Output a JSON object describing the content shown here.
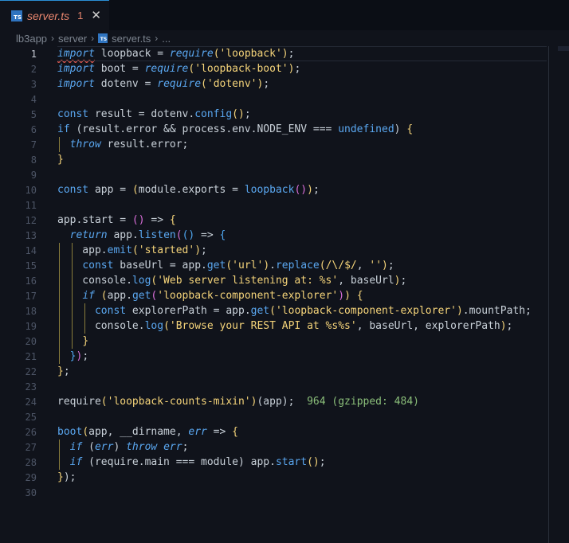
{
  "tab": {
    "filename": "server.ts",
    "problems": "1",
    "close": "✕",
    "badge": "TS"
  },
  "breadcrumb": {
    "root": "lb3app",
    "folder": "server",
    "file": "server.ts",
    "more": "...",
    "sep": "›"
  },
  "inlay_hint": "964 (gzipped: 484)",
  "colors": {
    "keyword": "#5aa7f0",
    "string": "#f5d47a",
    "error": "#e8866e",
    "hint": "#8bbf7a"
  },
  "lines": [
    {
      "n": "1",
      "t": [
        [
          "k",
          "import"
        ],
        [
          "m",
          " loopback = "
        ],
        [
          "f",
          "require"
        ],
        [
          "p",
          "("
        ],
        [
          "s",
          "'loopback'"
        ],
        [
          "p",
          ")"
        ],
        [
          "m",
          ";"
        ]
      ]
    },
    {
      "n": "2",
      "t": [
        [
          "k",
          "import"
        ],
        [
          "m",
          " boot = "
        ],
        [
          "f",
          "require"
        ],
        [
          "p",
          "("
        ],
        [
          "s",
          "'loopback-boot'"
        ],
        [
          "p",
          ")"
        ],
        [
          "m",
          ";"
        ]
      ]
    },
    {
      "n": "3",
      "t": [
        [
          "k",
          "import"
        ],
        [
          "m",
          " dotenv = "
        ],
        [
          "f",
          "require"
        ],
        [
          "p",
          "("
        ],
        [
          "s",
          "'dotenv'"
        ],
        [
          "p",
          ")"
        ],
        [
          "m",
          ";"
        ]
      ]
    },
    {
      "n": "4",
      "t": []
    },
    {
      "n": "5",
      "t": [
        [
          "d",
          "const"
        ],
        [
          "m",
          " result = dotenv."
        ],
        [
          "d",
          "config"
        ],
        [
          "p",
          "()"
        ],
        [
          "m",
          ";"
        ]
      ]
    },
    {
      "n": "6",
      "t": [
        [
          "d",
          "if"
        ],
        [
          "m",
          " (result.error && process.env.NODE_ENV === "
        ],
        [
          "d",
          "undefined"
        ],
        [
          "m",
          ") "
        ],
        [
          "p",
          "{"
        ]
      ]
    },
    {
      "n": "7",
      "t": [
        [
          "m",
          "  "
        ],
        [
          "k",
          "throw"
        ],
        [
          "m",
          " result.error;"
        ]
      ]
    },
    {
      "n": "8",
      "t": [
        [
          "p",
          "}"
        ]
      ]
    },
    {
      "n": "9",
      "t": []
    },
    {
      "n": "10",
      "t": [
        [
          "d",
          "const"
        ],
        [
          "m",
          " app = "
        ],
        [
          "p",
          "("
        ],
        [
          "m",
          "module.exports = "
        ],
        [
          "d",
          "loopback"
        ],
        [
          "pp",
          "()"
        ],
        [
          "p",
          ")"
        ],
        [
          "m",
          ";"
        ]
      ]
    },
    {
      "n": "11",
      "t": []
    },
    {
      "n": "12",
      "t": [
        [
          "m",
          "app.start = "
        ],
        [
          "pp",
          "()"
        ],
        [
          "m",
          " => "
        ],
        [
          "p",
          "{"
        ]
      ]
    },
    {
      "n": "13",
      "t": [
        [
          "m",
          "  "
        ],
        [
          "k",
          "return"
        ],
        [
          "m",
          " app."
        ],
        [
          "d",
          "listen"
        ],
        [
          "pp",
          "("
        ],
        [
          "pb",
          "()"
        ],
        [
          "m",
          " => "
        ],
        [
          "pb",
          "{"
        ]
      ]
    },
    {
      "n": "14",
      "t": [
        [
          "m",
          "    app."
        ],
        [
          "d",
          "emit"
        ],
        [
          "p",
          "("
        ],
        [
          "s",
          "'started'"
        ],
        [
          "p",
          ")"
        ],
        [
          "m",
          ";"
        ]
      ]
    },
    {
      "n": "15",
      "t": [
        [
          "m",
          "    "
        ],
        [
          "d",
          "const"
        ],
        [
          "m",
          " baseUrl = app."
        ],
        [
          "d",
          "get"
        ],
        [
          "p",
          "("
        ],
        [
          "s",
          "'url'"
        ],
        [
          "p",
          ")"
        ],
        [
          "m",
          "."
        ],
        [
          "d",
          "replace"
        ],
        [
          "p",
          "("
        ],
        [
          "s",
          "/\\/$/"
        ],
        [
          "m",
          ", "
        ],
        [
          "s",
          "''"
        ],
        [
          "p",
          ")"
        ],
        [
          "m",
          ";"
        ]
      ]
    },
    {
      "n": "16",
      "t": [
        [
          "m",
          "    console."
        ],
        [
          "d",
          "log"
        ],
        [
          "p",
          "("
        ],
        [
          "s",
          "'Web server listening at: %s'"
        ],
        [
          "m",
          ", baseUrl"
        ],
        [
          "p",
          ")"
        ],
        [
          "m",
          ";"
        ]
      ]
    },
    {
      "n": "17",
      "t": [
        [
          "m",
          "    "
        ],
        [
          "k",
          "if"
        ],
        [
          "m",
          " "
        ],
        [
          "p",
          "("
        ],
        [
          "m",
          "app."
        ],
        [
          "d",
          "get"
        ],
        [
          "pp",
          "("
        ],
        [
          "s",
          "'loopback-component-explorer'"
        ],
        [
          "pp",
          ")"
        ],
        [
          "p",
          ")"
        ],
        [
          "m",
          " "
        ],
        [
          "p",
          "{"
        ]
      ]
    },
    {
      "n": "18",
      "t": [
        [
          "m",
          "      "
        ],
        [
          "d",
          "const"
        ],
        [
          "m",
          " explorerPath = app."
        ],
        [
          "d",
          "get"
        ],
        [
          "p",
          "("
        ],
        [
          "s",
          "'loopback-component-explorer'"
        ],
        [
          "p",
          ")"
        ],
        [
          "m",
          ".mountPath;"
        ]
      ]
    },
    {
      "n": "19",
      "t": [
        [
          "m",
          "      console."
        ],
        [
          "d",
          "log"
        ],
        [
          "p",
          "("
        ],
        [
          "s",
          "'Browse your REST API at %s%s'"
        ],
        [
          "m",
          ", baseUrl, explorerPath"
        ],
        [
          "p",
          ")"
        ],
        [
          "m",
          ";"
        ]
      ]
    },
    {
      "n": "20",
      "t": [
        [
          "m",
          "    "
        ],
        [
          "p",
          "}"
        ]
      ]
    },
    {
      "n": "21",
      "t": [
        [
          "m",
          "  "
        ],
        [
          "pb",
          "}"
        ],
        [
          "pp",
          ")"
        ],
        [
          "m",
          ";"
        ]
      ]
    },
    {
      "n": "22",
      "t": [
        [
          "p",
          "}"
        ],
        [
          "m",
          ";"
        ]
      ]
    },
    {
      "n": "23",
      "t": []
    },
    {
      "n": "24",
      "t": [
        [
          "m",
          "require"
        ],
        [
          "p",
          "("
        ],
        [
          "s",
          "'loopback-counts-mixin'"
        ],
        [
          "p",
          ")"
        ],
        [
          "m",
          "(app);  "
        ],
        [
          "hint",
          "964 (gzipped: 484)"
        ]
      ]
    },
    {
      "n": "25",
      "t": []
    },
    {
      "n": "26",
      "t": [
        [
          "d",
          "boot"
        ],
        [
          "p",
          "("
        ],
        [
          "m",
          "app, __dirname, "
        ],
        [
          "f",
          "err"
        ],
        [
          "m",
          " => "
        ],
        [
          "p",
          "{"
        ]
      ]
    },
    {
      "n": "27",
      "t": [
        [
          "m",
          "  "
        ],
        [
          "k",
          "if"
        ],
        [
          "m",
          " ("
        ],
        [
          "f",
          "err"
        ],
        [
          "m",
          ") "
        ],
        [
          "k",
          "throw"
        ],
        [
          "m",
          " "
        ],
        [
          "f",
          "err"
        ],
        [
          "m",
          ";"
        ]
      ]
    },
    {
      "n": "28",
      "t": [
        [
          "m",
          "  "
        ],
        [
          "k",
          "if"
        ],
        [
          "m",
          " (require.main === module) app."
        ],
        [
          "d",
          "start"
        ],
        [
          "p",
          "()"
        ],
        [
          "m",
          ";"
        ]
      ]
    },
    {
      "n": "29",
      "t": [
        [
          "p",
          "}"
        ],
        [
          "m",
          ");"
        ]
      ]
    },
    {
      "n": "30",
      "t": []
    }
  ]
}
